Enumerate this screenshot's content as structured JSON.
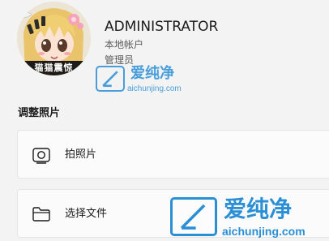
{
  "profile": {
    "avatar_caption": "猫猫震惊",
    "user_name": "ADMINISTRATOR",
    "account_type": "本地帐户",
    "account_role": "管理员"
  },
  "adjust_photo": {
    "section_title": "调整照片",
    "options": [
      {
        "label": "拍照片",
        "icon": "camera-icon"
      },
      {
        "label": "选择文件",
        "icon": "folder-icon"
      }
    ]
  },
  "watermark": {
    "brand": "爱纯净",
    "url": "aichunjing.com",
    "color": "#2b8fd6"
  },
  "colors": {
    "background": "#f3f3f3",
    "card": "#fbfbfb",
    "text": "#1b1b1b",
    "secondary_text": "#5c5c5c"
  }
}
